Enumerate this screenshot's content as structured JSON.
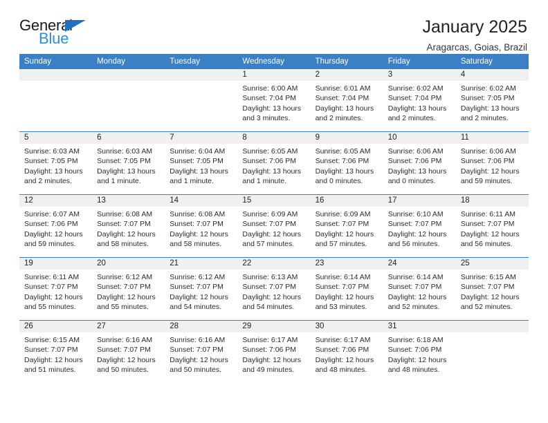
{
  "logo": {
    "word1": "General",
    "word2": "Blue",
    "triangle_color": "#1f72bd",
    "blue_color": "#2d8fd5"
  },
  "header": {
    "title": "January 2025",
    "subtitle": "Aragarcas, Goias, Brazil"
  },
  "theme": {
    "header_bg": "#3b7fc4",
    "daynum_bg": "#f0f0f0",
    "grid_line": "#3b7fc4"
  },
  "weekday_headers": [
    "Sunday",
    "Monday",
    "Tuesday",
    "Wednesday",
    "Thursday",
    "Friday",
    "Saturday"
  ],
  "labels": {
    "sunrise": "Sunrise:",
    "sunset": "Sunset:",
    "daylight": "Daylight:"
  },
  "weeks": [
    [
      {
        "day": "",
        "empty": true
      },
      {
        "day": "",
        "empty": true
      },
      {
        "day": "",
        "empty": true
      },
      {
        "day": "1",
        "sunrise": "Sunrise: 6:00 AM",
        "sunset": "Sunset: 7:04 PM",
        "daylight": "Daylight: 13 hours and 3 minutes."
      },
      {
        "day": "2",
        "sunrise": "Sunrise: 6:01 AM",
        "sunset": "Sunset: 7:04 PM",
        "daylight": "Daylight: 13 hours and 2 minutes."
      },
      {
        "day": "3",
        "sunrise": "Sunrise: 6:02 AM",
        "sunset": "Sunset: 7:04 PM",
        "daylight": "Daylight: 13 hours and 2 minutes."
      },
      {
        "day": "4",
        "sunrise": "Sunrise: 6:02 AM",
        "sunset": "Sunset: 7:05 PM",
        "daylight": "Daylight: 13 hours and 2 minutes."
      }
    ],
    [
      {
        "day": "5",
        "sunrise": "Sunrise: 6:03 AM",
        "sunset": "Sunset: 7:05 PM",
        "daylight": "Daylight: 13 hours and 2 minutes."
      },
      {
        "day": "6",
        "sunrise": "Sunrise: 6:03 AM",
        "sunset": "Sunset: 7:05 PM",
        "daylight": "Daylight: 13 hours and 1 minute."
      },
      {
        "day": "7",
        "sunrise": "Sunrise: 6:04 AM",
        "sunset": "Sunset: 7:05 PM",
        "daylight": "Daylight: 13 hours and 1 minute."
      },
      {
        "day": "8",
        "sunrise": "Sunrise: 6:05 AM",
        "sunset": "Sunset: 7:06 PM",
        "daylight": "Daylight: 13 hours and 1 minute."
      },
      {
        "day": "9",
        "sunrise": "Sunrise: 6:05 AM",
        "sunset": "Sunset: 7:06 PM",
        "daylight": "Daylight: 13 hours and 0 minutes."
      },
      {
        "day": "10",
        "sunrise": "Sunrise: 6:06 AM",
        "sunset": "Sunset: 7:06 PM",
        "daylight": "Daylight: 13 hours and 0 minutes."
      },
      {
        "day": "11",
        "sunrise": "Sunrise: 6:06 AM",
        "sunset": "Sunset: 7:06 PM",
        "daylight": "Daylight: 12 hours and 59 minutes."
      }
    ],
    [
      {
        "day": "12",
        "sunrise": "Sunrise: 6:07 AM",
        "sunset": "Sunset: 7:06 PM",
        "daylight": "Daylight: 12 hours and 59 minutes."
      },
      {
        "day": "13",
        "sunrise": "Sunrise: 6:08 AM",
        "sunset": "Sunset: 7:07 PM",
        "daylight": "Daylight: 12 hours and 58 minutes."
      },
      {
        "day": "14",
        "sunrise": "Sunrise: 6:08 AM",
        "sunset": "Sunset: 7:07 PM",
        "daylight": "Daylight: 12 hours and 58 minutes."
      },
      {
        "day": "15",
        "sunrise": "Sunrise: 6:09 AM",
        "sunset": "Sunset: 7:07 PM",
        "daylight": "Daylight: 12 hours and 57 minutes."
      },
      {
        "day": "16",
        "sunrise": "Sunrise: 6:09 AM",
        "sunset": "Sunset: 7:07 PM",
        "daylight": "Daylight: 12 hours and 57 minutes."
      },
      {
        "day": "17",
        "sunrise": "Sunrise: 6:10 AM",
        "sunset": "Sunset: 7:07 PM",
        "daylight": "Daylight: 12 hours and 56 minutes."
      },
      {
        "day": "18",
        "sunrise": "Sunrise: 6:11 AM",
        "sunset": "Sunset: 7:07 PM",
        "daylight": "Daylight: 12 hours and 56 minutes."
      }
    ],
    [
      {
        "day": "19",
        "sunrise": "Sunrise: 6:11 AM",
        "sunset": "Sunset: 7:07 PM",
        "daylight": "Daylight: 12 hours and 55 minutes."
      },
      {
        "day": "20",
        "sunrise": "Sunrise: 6:12 AM",
        "sunset": "Sunset: 7:07 PM",
        "daylight": "Daylight: 12 hours and 55 minutes."
      },
      {
        "day": "21",
        "sunrise": "Sunrise: 6:12 AM",
        "sunset": "Sunset: 7:07 PM",
        "daylight": "Daylight: 12 hours and 54 minutes."
      },
      {
        "day": "22",
        "sunrise": "Sunrise: 6:13 AM",
        "sunset": "Sunset: 7:07 PM",
        "daylight": "Daylight: 12 hours and 54 minutes."
      },
      {
        "day": "23",
        "sunrise": "Sunrise: 6:14 AM",
        "sunset": "Sunset: 7:07 PM",
        "daylight": "Daylight: 12 hours and 53 minutes."
      },
      {
        "day": "24",
        "sunrise": "Sunrise: 6:14 AM",
        "sunset": "Sunset: 7:07 PM",
        "daylight": "Daylight: 12 hours and 52 minutes."
      },
      {
        "day": "25",
        "sunrise": "Sunrise: 6:15 AM",
        "sunset": "Sunset: 7:07 PM",
        "daylight": "Daylight: 12 hours and 52 minutes."
      }
    ],
    [
      {
        "day": "26",
        "sunrise": "Sunrise: 6:15 AM",
        "sunset": "Sunset: 7:07 PM",
        "daylight": "Daylight: 12 hours and 51 minutes."
      },
      {
        "day": "27",
        "sunrise": "Sunrise: 6:16 AM",
        "sunset": "Sunset: 7:07 PM",
        "daylight": "Daylight: 12 hours and 50 minutes."
      },
      {
        "day": "28",
        "sunrise": "Sunrise: 6:16 AM",
        "sunset": "Sunset: 7:07 PM",
        "daylight": "Daylight: 12 hours and 50 minutes."
      },
      {
        "day": "29",
        "sunrise": "Sunrise: 6:17 AM",
        "sunset": "Sunset: 7:06 PM",
        "daylight": "Daylight: 12 hours and 49 minutes."
      },
      {
        "day": "30",
        "sunrise": "Sunrise: 6:17 AM",
        "sunset": "Sunset: 7:06 PM",
        "daylight": "Daylight: 12 hours and 48 minutes."
      },
      {
        "day": "31",
        "sunrise": "Sunrise: 6:18 AM",
        "sunset": "Sunset: 7:06 PM",
        "daylight": "Daylight: 12 hours and 48 minutes."
      },
      {
        "day": "",
        "empty": true
      }
    ]
  ]
}
